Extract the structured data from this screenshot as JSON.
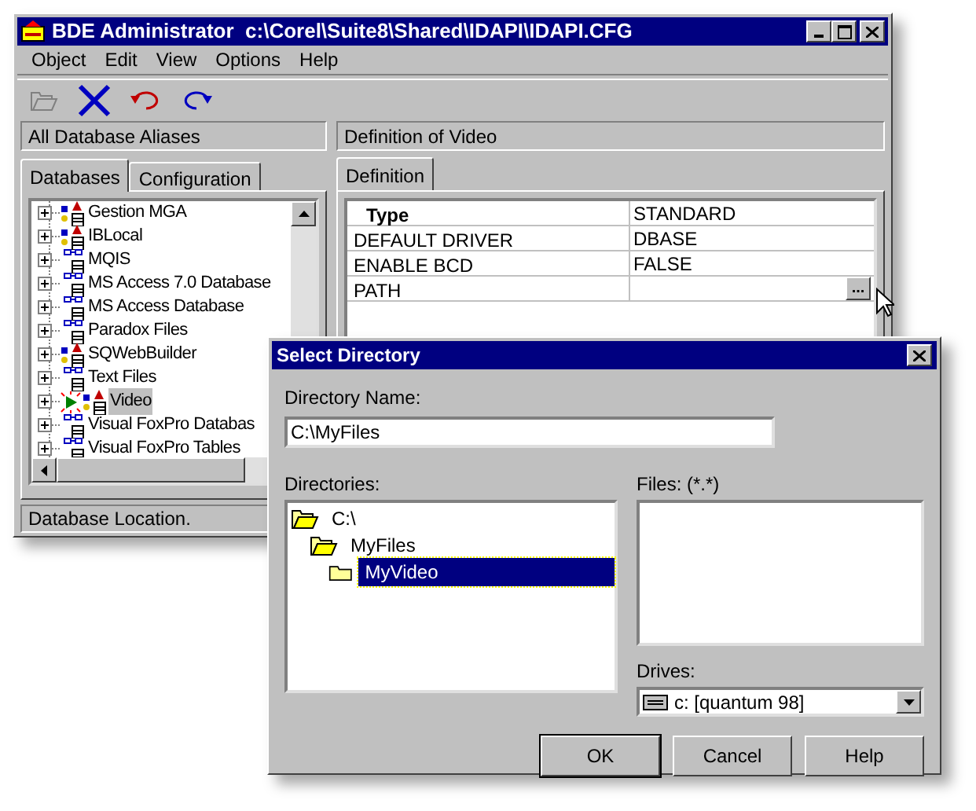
{
  "window": {
    "title": "BDE Administrator  c:\\Corel\\Suite8\\Shared\\IDAPI\\IDAPI.CFG"
  },
  "menu": [
    "Object",
    "Edit",
    "View",
    "Options",
    "Help"
  ],
  "toolbar": [
    {
      "kind": "open",
      "disabled": true
    },
    {
      "kind": "delete",
      "disabled": false
    },
    {
      "kind": "undo",
      "disabled": false
    },
    {
      "kind": "redo",
      "disabled": false
    }
  ],
  "left_header": "All Database Aliases",
  "right_header": "Definition of Video",
  "left_tabs": [
    {
      "label": "Databases",
      "selected": true
    },
    {
      "label": "Configuration",
      "selected": false
    }
  ],
  "tree": [
    {
      "label": "Gestion MGA",
      "kind": "native",
      "open": false,
      "selected": false
    },
    {
      "label": "IBLocal",
      "kind": "native",
      "open": false,
      "selected": false
    },
    {
      "label": "MQIS",
      "kind": "odbc",
      "open": false,
      "selected": false
    },
    {
      "label": "MS Access 7.0 Database",
      "kind": "odbc",
      "open": false,
      "selected": false
    },
    {
      "label": "MS Access Database",
      "kind": "odbc",
      "open": false,
      "selected": false
    },
    {
      "label": "Paradox Files",
      "kind": "odbc",
      "open": false,
      "selected": false
    },
    {
      "label": "SQWebBuilder",
      "kind": "native",
      "open": false,
      "selected": false
    },
    {
      "label": "Text Files",
      "kind": "odbc",
      "open": false,
      "selected": false
    },
    {
      "label": "Video",
      "kind": "native",
      "open": true,
      "selected": true
    },
    {
      "label": "Visual FoxPro Databas",
      "kind": "odbc",
      "open": false,
      "selected": false
    },
    {
      "label": "Visual FoxPro Tables",
      "kind": "odbc",
      "open": false,
      "selected": false
    }
  ],
  "right_tabs": [
    {
      "label": "Definition",
      "selected": true
    }
  ],
  "definition": [
    {
      "name": "Type",
      "value": "STANDARD",
      "kind": "header"
    },
    {
      "name": "DEFAULT DRIVER",
      "value": "DBASE",
      "kind": "text"
    },
    {
      "name": "ENABLE BCD",
      "value": "FALSE",
      "kind": "text"
    },
    {
      "name": "PATH",
      "kind": "browse",
      "button": "..."
    }
  ],
  "status_bar": "Database Location.",
  "dialog": {
    "title": "Select Directory",
    "name_label": "Directory Name:",
    "name_value": "C:\\MyFiles",
    "dirs_label": "Directories:",
    "directories": [
      {
        "label": "C:\\",
        "kind": "open",
        "selected": false,
        "children": [
          {
            "label": "MyFiles",
            "kind": "open",
            "selected": false,
            "children": [
              {
                "label": "MyVideo",
                "kind": "closed",
                "selected": true
              }
            ]
          }
        ]
      }
    ],
    "files_label": "Files: (*.*)",
    "drives_label": "Drives:",
    "drive": "c: [quantum 98]",
    "buttons": [
      {
        "label": "OK",
        "default": true
      },
      {
        "label": "Cancel",
        "default": false
      },
      {
        "label": "Help",
        "default": false
      }
    ]
  }
}
